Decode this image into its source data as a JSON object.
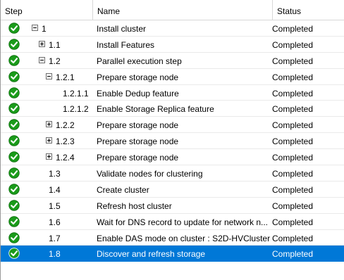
{
  "columns": {
    "step": "Step",
    "name": "Name",
    "status": "Status"
  },
  "rows": [
    {
      "step": "1",
      "level": 0,
      "expander": "minus",
      "name": "Install cluster",
      "status": "Completed",
      "icon": "check-icon"
    },
    {
      "step": "1.1",
      "level": 1,
      "expander": "plus",
      "name": "Install Features",
      "status": "Completed",
      "icon": "check-icon"
    },
    {
      "step": "1.2",
      "level": 1,
      "expander": "minus",
      "name": "Parallel execution step",
      "status": "Completed",
      "icon": "check-icon"
    },
    {
      "step": "1.2.1",
      "level": 2,
      "expander": "minus",
      "name": "Prepare storage node",
      "status": "Completed",
      "icon": "check-icon"
    },
    {
      "step": "1.2.1.1",
      "level": 3,
      "expander": "none",
      "name": "Enable Dedup feature",
      "status": "Completed",
      "icon": "check-icon"
    },
    {
      "step": "1.2.1.2",
      "level": 3,
      "expander": "none",
      "name": "Enable Storage Replica feature",
      "status": "Completed",
      "icon": "check-icon"
    },
    {
      "step": "1.2.2",
      "level": 2,
      "expander": "plus",
      "name": "Prepare storage node",
      "status": "Completed",
      "icon": "check-icon"
    },
    {
      "step": "1.2.3",
      "level": 2,
      "expander": "plus",
      "name": "Prepare storage node",
      "status": "Completed",
      "icon": "check-icon"
    },
    {
      "step": "1.2.4",
      "level": 2,
      "expander": "plus",
      "name": "Prepare storage node",
      "status": "Completed",
      "icon": "check-icon"
    },
    {
      "step": "1.3",
      "level": 1,
      "expander": "none",
      "name": "Validate nodes for clustering",
      "status": "Completed",
      "icon": "check-icon"
    },
    {
      "step": "1.4",
      "level": 1,
      "expander": "none",
      "name": "Create cluster",
      "status": "Completed",
      "icon": "check-icon"
    },
    {
      "step": "1.5",
      "level": 1,
      "expander": "none",
      "name": "Refresh host cluster",
      "status": "Completed",
      "icon": "check-icon"
    },
    {
      "step": "1.6",
      "level": 1,
      "expander": "none",
      "name": "Wait for DNS record to update for network n...",
      "status": "Completed",
      "icon": "check-icon"
    },
    {
      "step": "1.7",
      "level": 1,
      "expander": "none",
      "name": "Enable DAS mode on cluster : S2D-HVCluster",
      "status": "Completed",
      "icon": "check-icon"
    },
    {
      "step": "1.8",
      "level": 1,
      "expander": "none",
      "name": "Discover and refresh storage",
      "status": "Completed",
      "icon": "check-icon",
      "selected": true
    }
  ],
  "colors": {
    "selection": "#0078d7",
    "check_green": "#1a9b1a"
  }
}
